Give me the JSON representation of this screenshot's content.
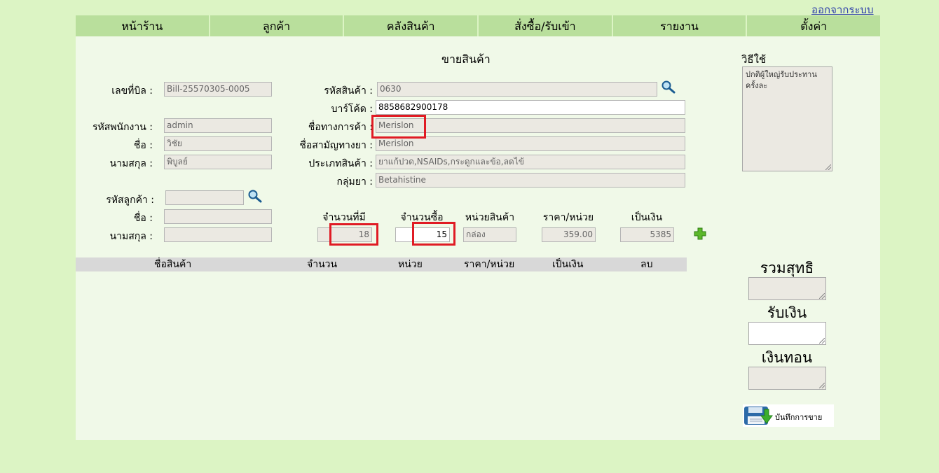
{
  "header": {
    "logout": "ออกจากระบบ"
  },
  "nav": [
    "หน้าร้าน",
    "ลูกค้า",
    "คลังสินค้า",
    "สั่งซื้อ/รับเข้า",
    "รายงาน",
    "ตั้งค่า"
  ],
  "page": {
    "title": "ขายสินค้า"
  },
  "bill": {
    "bill_no_label": "เลขที่บิล :",
    "bill_no": "Bill-25570305-0005",
    "emp_id_label": "รหัสพนักงาน :",
    "emp_id": "admin",
    "first_name_label": "ชื่อ :",
    "first_name": "วิชัย",
    "last_name_label": "นามสกุล :",
    "last_name": "พิบูลย์"
  },
  "product": {
    "code_label": "รหัสสินค้า :",
    "code": "0630",
    "barcode_label": "บาร์โค้ด :",
    "barcode": "8858682900178",
    "trade_name_label": "ชื่อทางการค้า :",
    "trade_name": "Merislon",
    "generic_name_label": "ชื่อสามัญทางยา :",
    "generic_name": "Merislon",
    "type_label": "ประเภทสินค้า :",
    "type": "ยาแก้ปวด,NSAIDs,กระดูกและข้อ,ลดไข้",
    "group_label": "กลุ่มยา :",
    "group": "Betahistine"
  },
  "customer": {
    "id_label": "รหัสลูกค้า :",
    "id": "",
    "first_name_label": "ชื่อ :",
    "first_name": "",
    "last_name_label": "นามสกุล :",
    "last_name": ""
  },
  "qty": {
    "stock_label": "จำนวนที่มี",
    "stock": "18",
    "buy_label": "จำนวนซื้อ",
    "buy": "15",
    "unit_label": "หน่วยสินค้า",
    "unit": "กล่อง",
    "price_label": "ราคา/หน่วย",
    "price": "359.00",
    "total_label": "เป็นเงิน",
    "total": "5385"
  },
  "table": {
    "headers": [
      "ชื่อสินค้า",
      "จำนวน",
      "หน่วย",
      "ราคา/หน่วย",
      "เป็นเงิน",
      "ลบ"
    ],
    "rows": []
  },
  "howto": {
    "label": "วิธีใช้",
    "text": "ปกติผู้ใหญ่รับประทานครั้งละ"
  },
  "summary": {
    "net_total_label": "รวมสุทธิ",
    "received_label": "รับเงิน",
    "change_label": "เงินทอน"
  },
  "save": {
    "label": "บันทึกการขาย"
  },
  "icons": {
    "search": "magnifier-icon",
    "add": "plus-icon",
    "save": "floppy-save-icon"
  },
  "colors": {
    "nav_bg": "#b9df9c",
    "page_bg": "#dcf4c4",
    "panel_bg": "#f0f9e8",
    "highlight": "#e01b24",
    "add_icon": "#5cb82a"
  }
}
